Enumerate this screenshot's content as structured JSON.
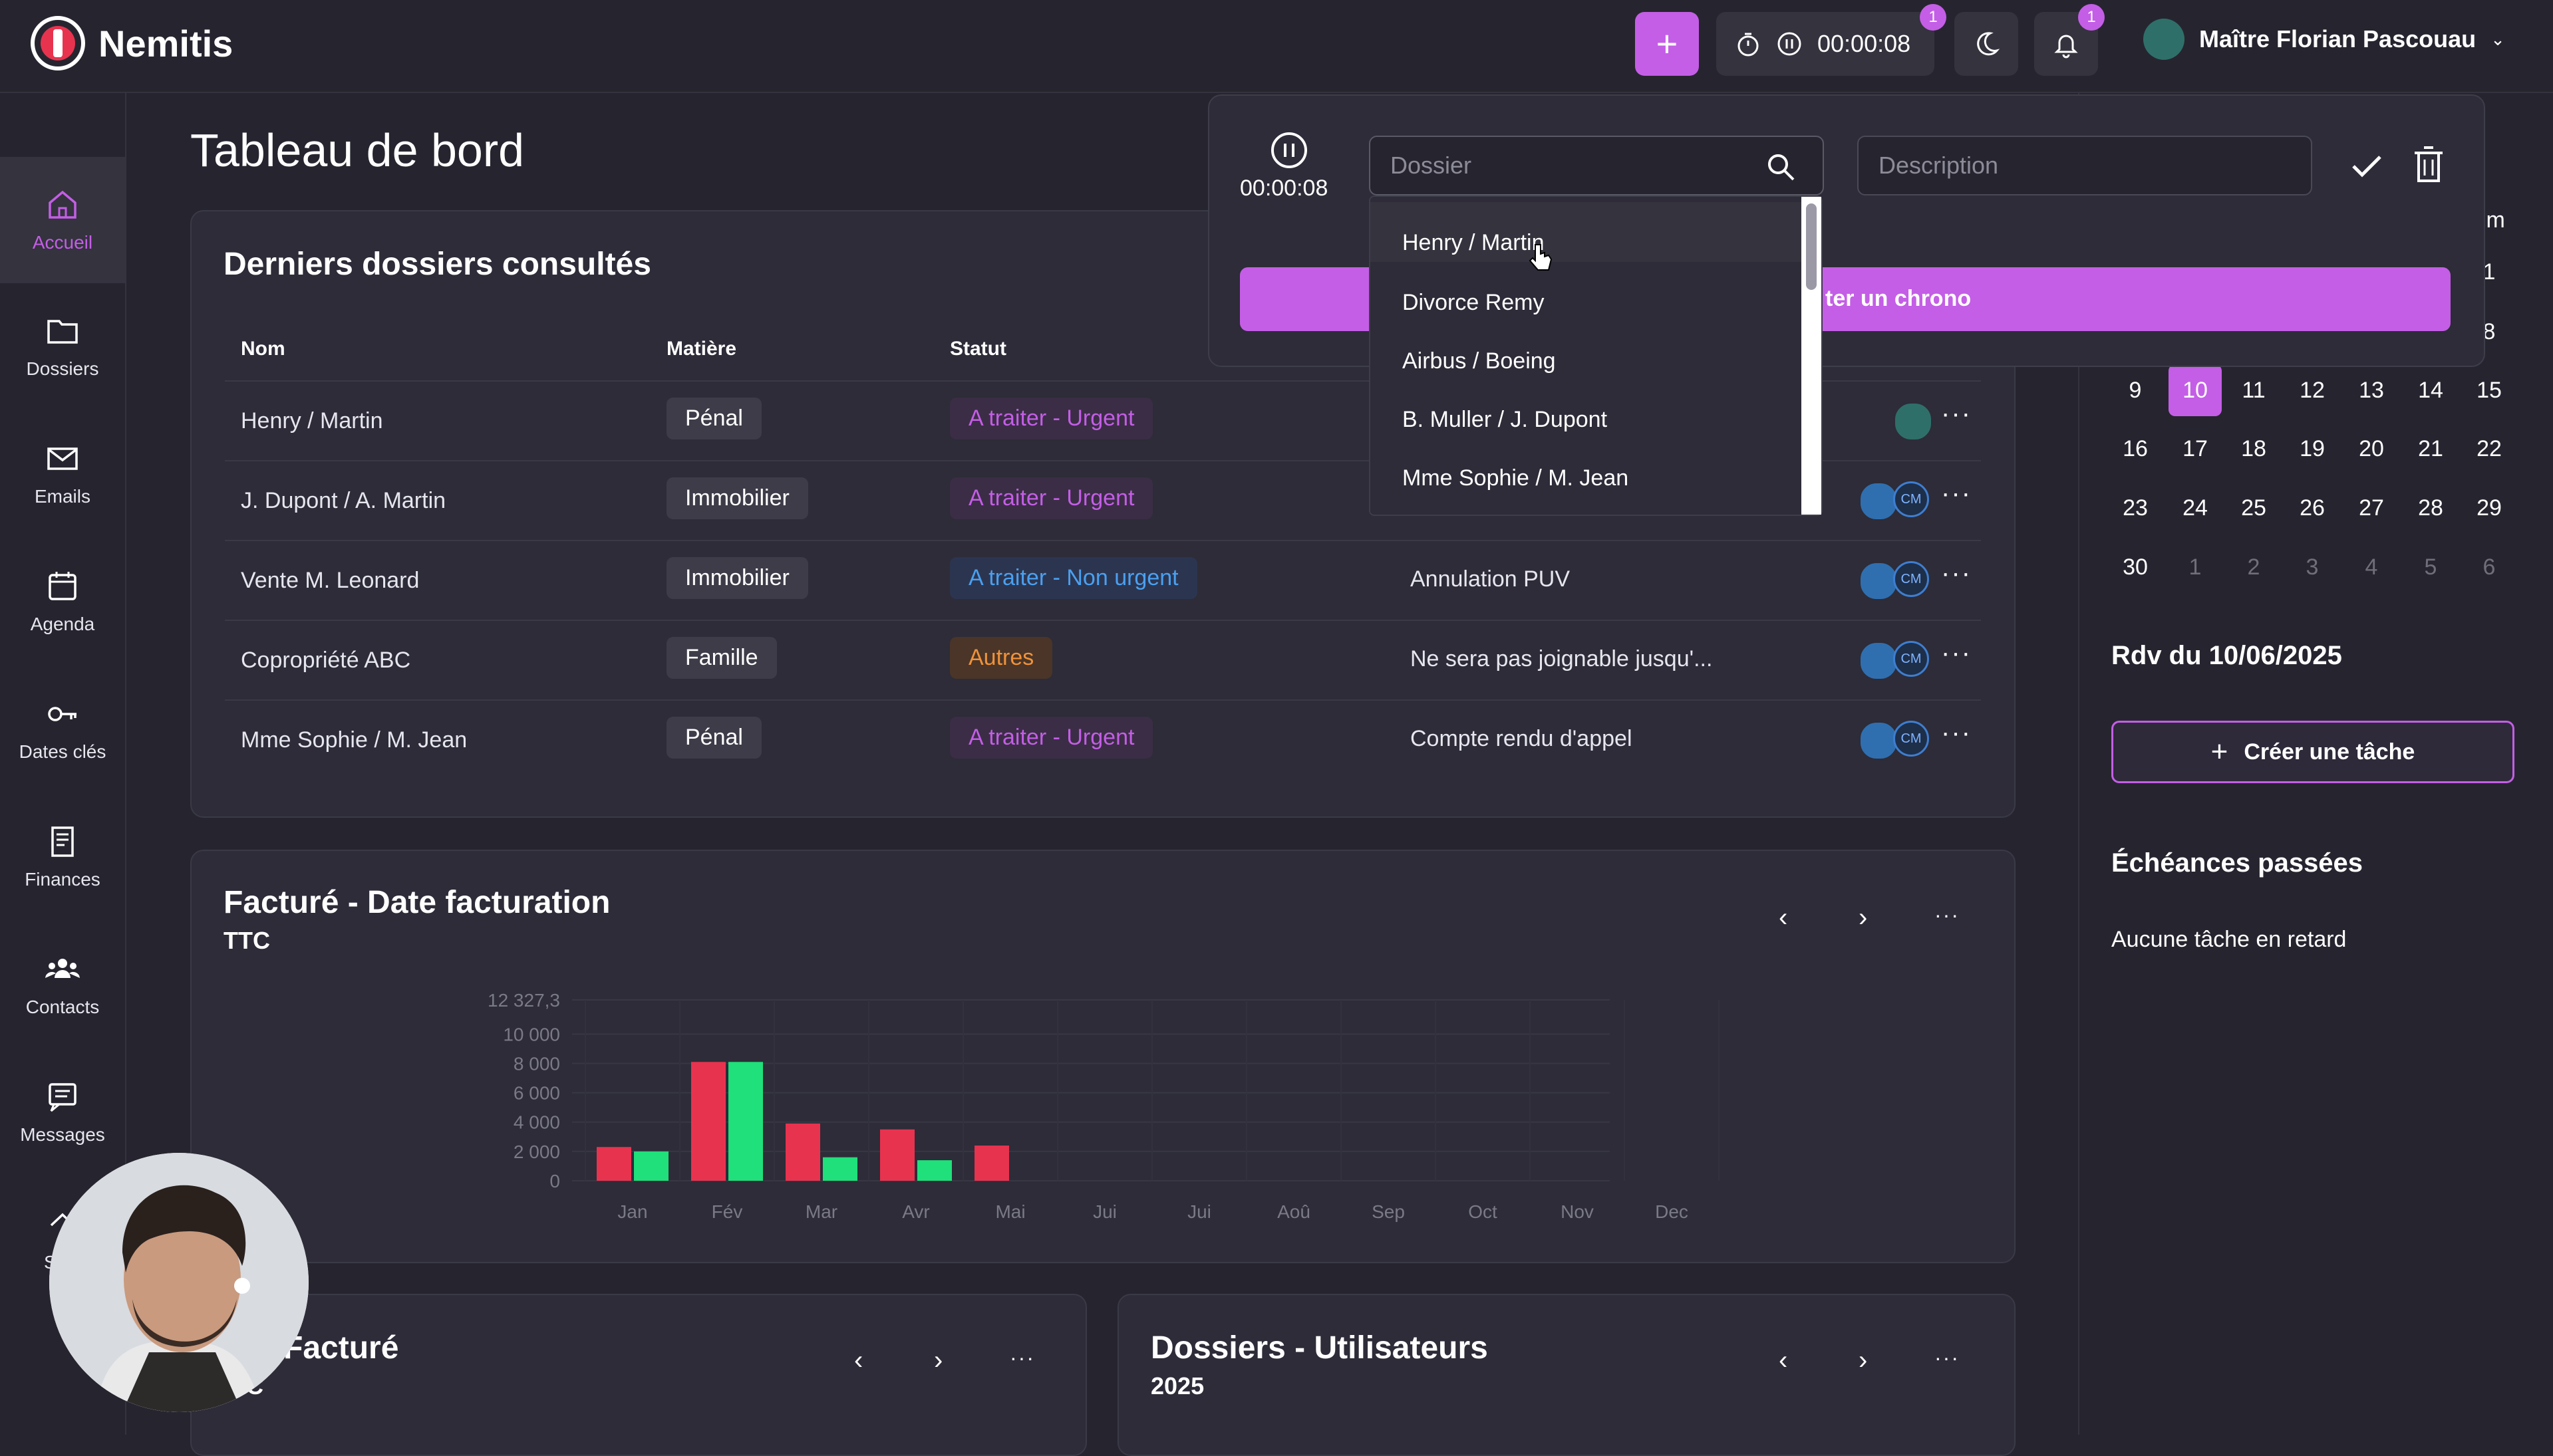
{
  "app": {
    "name": "Nemitis"
  },
  "topbar": {
    "timer": "00:00:08",
    "timer_badge": "1",
    "notif_badge": "1",
    "user_name": "Maître Florian Pascouau"
  },
  "sidebar": {
    "items": [
      {
        "label": "Accueil",
        "icon": "home-icon"
      },
      {
        "label": "Dossiers",
        "icon": "folder-icon"
      },
      {
        "label": "Emails",
        "icon": "mail-icon"
      },
      {
        "label": "Agenda",
        "icon": "calendar-icon"
      },
      {
        "label": "Dates clés",
        "icon": "key-icon"
      },
      {
        "label": "Finances",
        "icon": "receipt-icon"
      },
      {
        "label": "Contacts",
        "icon": "users-icon"
      },
      {
        "label": "Messages",
        "icon": "message-icon"
      },
      {
        "label": "Stati",
        "icon": "stats-icon"
      }
    ]
  },
  "page": {
    "title": "Tableau de bord"
  },
  "recent": {
    "title": "Derniers dossiers consultés",
    "headers": [
      "Nom",
      "Matière",
      "Statut"
    ],
    "rows": [
      {
        "nom": "Henry / Martin",
        "matiere": "Pénal",
        "statut": "A traiter - Urgent",
        "note": ""
      },
      {
        "nom": "J. Dupont / A. Martin",
        "matiere": "Immobilier",
        "statut": "A traiter - Urgent",
        "note": ""
      },
      {
        "nom": "Vente M. Leonard",
        "matiere": "Immobilier",
        "statut": "A traiter - Non urgent",
        "note": "Annulation PUV"
      },
      {
        "nom": "Copropriété ABC",
        "matiere": "Famille",
        "statut": "Autres",
        "note": "Ne sera pas joignable jusqu'..."
      },
      {
        "nom": "Mme Sophie / M. Jean",
        "matiere": "Pénal",
        "statut": "A traiter - Urgent",
        "note": "Compte rendu d'appel"
      }
    ],
    "avatar_initials": "CM"
  },
  "timer_popup": {
    "time": "00:00:08",
    "dossier_placeholder": "Dossier",
    "description_placeholder": "Description",
    "button_label": "ter un chrono",
    "options": [
      "Henry / Martin",
      "Divorce Remy",
      "Airbus / Boeing",
      "B. Muller / J. Dupont",
      "Mme Sophie / M. Jean"
    ]
  },
  "calendar": {
    "header_partial": "im",
    "rows": [
      [
        {
          "d": "",
          "dim": false
        },
        {
          "d": "",
          "dim": false
        },
        {
          "d": "",
          "dim": false
        },
        {
          "d": "",
          "dim": false
        },
        {
          "d": "",
          "dim": false
        },
        {
          "d": "",
          "dim": false
        },
        {
          "d": "1",
          "dim": false
        }
      ],
      [
        {
          "d": "",
          "dim": false
        },
        {
          "d": "",
          "dim": false
        },
        {
          "d": "",
          "dim": false
        },
        {
          "d": "",
          "dim": false
        },
        {
          "d": "",
          "dim": false
        },
        {
          "d": "",
          "dim": false
        },
        {
          "d": "8",
          "dim": false
        }
      ],
      [
        {
          "d": "9",
          "dim": false
        },
        {
          "d": "10",
          "dim": false,
          "sel": true
        },
        {
          "d": "11",
          "dim": false
        },
        {
          "d": "12",
          "dim": false
        },
        {
          "d": "13",
          "dim": false
        },
        {
          "d": "14",
          "dim": false
        },
        {
          "d": "15",
          "dim": false
        }
      ],
      [
        {
          "d": "16",
          "dim": false
        },
        {
          "d": "17",
          "dim": false
        },
        {
          "d": "18",
          "dim": false
        },
        {
          "d": "19",
          "dim": false
        },
        {
          "d": "20",
          "dim": false
        },
        {
          "d": "21",
          "dim": false
        },
        {
          "d": "22",
          "dim": false
        }
      ],
      [
        {
          "d": "23",
          "dim": false
        },
        {
          "d": "24",
          "dim": false
        },
        {
          "d": "25",
          "dim": false
        },
        {
          "d": "26",
          "dim": false
        },
        {
          "d": "27",
          "dim": false
        },
        {
          "d": "28",
          "dim": false
        },
        {
          "d": "29",
          "dim": false
        }
      ],
      [
        {
          "d": "30",
          "dim": false
        },
        {
          "d": "1",
          "dim": true
        },
        {
          "d": "2",
          "dim": true
        },
        {
          "d": "3",
          "dim": true
        },
        {
          "d": "4",
          "dim": true
        },
        {
          "d": "5",
          "dim": true
        },
        {
          "d": "6",
          "dim": true
        }
      ]
    ],
    "rdv_title": "Rdv du 10/06/2025",
    "create_task": "Créer une tâche",
    "past_title": "Échéances passées",
    "past_empty": "Aucune tâche en retard"
  },
  "billing_card": {
    "title": "Facturé - Date facturation",
    "subtitle": "TTC"
  },
  "chart_data": {
    "type": "bar",
    "categories": [
      "Jan",
      "Fév",
      "Mar",
      "Avr",
      "Mai",
      "Jui",
      "Jui",
      "Aoû",
      "Sep",
      "Oct",
      "Nov",
      "Dec"
    ],
    "series": [
      {
        "color": "#e8334f",
        "values": [
          2300,
          8100,
          3900,
          3500,
          2400,
          0,
          0,
          0,
          0,
          0,
          0,
          0
        ]
      },
      {
        "color": "#1fe07a",
        "values": [
          2000,
          8100,
          1600,
          1400,
          0,
          0,
          0,
          0,
          0,
          0,
          0,
          0
        ]
      }
    ],
    "yticks": [
      "0",
      "2 000",
      "4 000",
      "6 000",
      "8 000",
      "10 000",
      "12 327,3"
    ],
    "ymax": 12327.3,
    "grid": true
  },
  "bottom_left": {
    "title": "Facturé",
    "subtitle": "C"
  },
  "bottom_right": {
    "title": "Dossiers - Utilisateurs",
    "subtitle": "2025"
  },
  "colors": {
    "accent": "#c45ee6",
    "bg": "#26252f",
    "card": "#2d2c38"
  }
}
